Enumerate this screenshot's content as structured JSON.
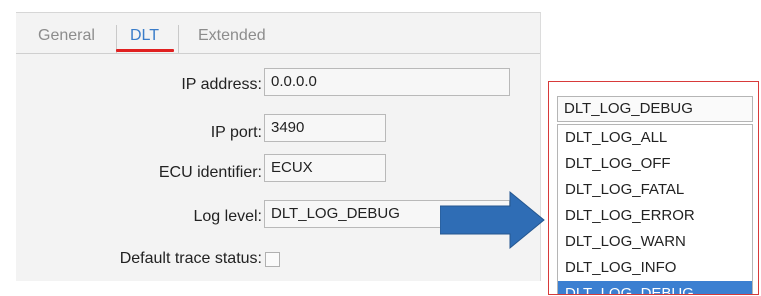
{
  "tabs": [
    {
      "label": "General",
      "active": false
    },
    {
      "label": "DLT",
      "active": true
    },
    {
      "label": "Extended",
      "active": false
    }
  ],
  "form": {
    "ip_address": {
      "label": "IP address:",
      "value": "0.0.0.0"
    },
    "ip_port": {
      "label": "IP port:",
      "value": "3490"
    },
    "ecu_identifier": {
      "label": "ECU identifier:",
      "value": "ECUX"
    },
    "log_level": {
      "label": "Log level:",
      "value": "DLT_LOG_DEBUG"
    },
    "default_trace_status": {
      "label": "Default trace status:",
      "checked": false
    }
  },
  "dropdown": {
    "selected": "DLT_LOG_DEBUG",
    "options": [
      "DLT_LOG_ALL",
      "DLT_LOG_OFF",
      "DLT_LOG_FATAL",
      "DLT_LOG_ERROR",
      "DLT_LOG_WARN",
      "DLT_LOG_INFO",
      "DLT_LOG_DEBUG"
    ],
    "highlighted": "DLT_LOG_DEBUG"
  },
  "colors": {
    "active_tab_text": "#3a7cc9",
    "active_tab_underline": "#e02020",
    "callout_border": "#d83a3a",
    "arrow": "#2f6db5",
    "highlight": "#3b7fd1"
  },
  "icons": {
    "arrow": "right-arrow-icon"
  }
}
